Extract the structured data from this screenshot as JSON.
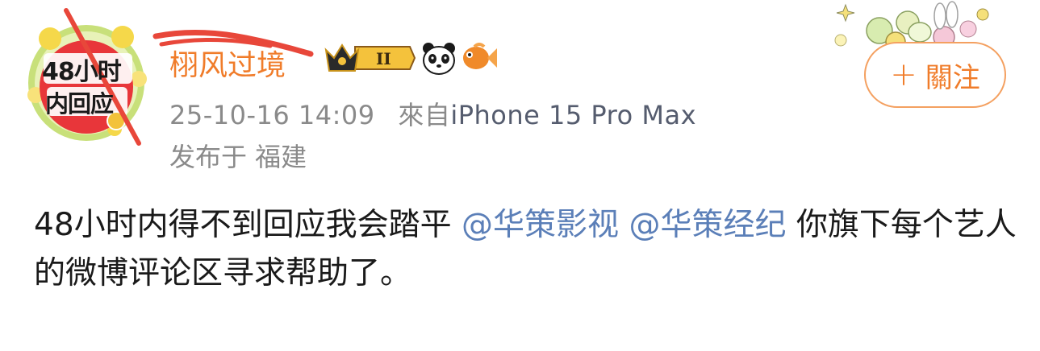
{
  "user": {
    "name": "栩风过境",
    "avatar_text_line1": "48小时",
    "avatar_text_line2": "内回应",
    "level_badge": "II",
    "icons": [
      "crown-badge-icon",
      "panda-icon",
      "goldfish-icon"
    ]
  },
  "post_meta": {
    "timestamp": "25-10-16 14:09",
    "source_prefix": "來自",
    "device": "iPhone 15 Pro Max",
    "location": "发布于 福建"
  },
  "follow_button": {
    "plus": "+",
    "label": "關注"
  },
  "content": {
    "part1": "48小时内得不到回应我会踏平 ",
    "mention1": "@华策影视",
    "mention2": "@华策经纪",
    "part2": " 你旗下每个艺人的微博评论区寻求帮助了。"
  },
  "colors": {
    "accent": "#f07c2a",
    "mention": "#5b7fb8",
    "meta": "#8a8a8a",
    "scribble": "#e8473a"
  }
}
